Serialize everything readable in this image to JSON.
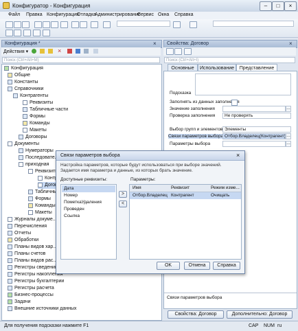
{
  "window": {
    "title": "Конфигуратор - Конфигурация"
  },
  "menu": [
    "Файл",
    "Правка",
    "Конфигурация",
    "Отладка",
    "Администрирование",
    "Сервис",
    "Окна",
    "Справка"
  ],
  "left_panel": {
    "title": "Конфигурация *",
    "actions_label": "Действия ▾",
    "search_placeholder": "Поиск (Ctrl+Alt+M)",
    "tree": [
      {
        "label": "Конфигурация",
        "icon": "config-icon"
      },
      {
        "label": "Общие",
        "icon": "folder-icon"
      },
      {
        "label": "Константы",
        "icon": "constant-icon"
      },
      {
        "label": "Справочники",
        "icon": "catalog-icon"
      },
      {
        "label": "Контрагенты",
        "icon": "catalog-icon"
      },
      {
        "label": "Реквизиты",
        "icon": "folder-icon"
      },
      {
        "label": "Табличные части",
        "icon": "table-icon"
      },
      {
        "label": "Формы",
        "icon": "form-icon"
      },
      {
        "label": "Команды",
        "icon": "command-icon"
      },
      {
        "label": "Макеты",
        "icon": "layout-icon"
      },
      {
        "label": "Договоры",
        "icon": "catalog-icon"
      },
      {
        "label": "Документы",
        "icon": "document-icon"
      },
      {
        "label": "Нумераторы",
        "icon": "numerator-icon"
      },
      {
        "label": "Последовате...",
        "icon": "sequence-icon"
      },
      {
        "label": "приходная",
        "icon": "document-icon"
      },
      {
        "label": "Реквизиты",
        "icon": "folder-icon"
      },
      {
        "label": "Контр...",
        "icon": "attribute-icon"
      },
      {
        "label": "Догов...",
        "icon": "attribute-icon"
      },
      {
        "label": "Табличны...",
        "icon": "table-icon"
      },
      {
        "label": "Формы",
        "icon": "form-icon"
      },
      {
        "label": "Команды",
        "icon": "command-icon"
      },
      {
        "label": "Макеты",
        "icon": "layout-icon"
      },
      {
        "label": "Журналы докуме...",
        "icon": "journal-icon"
      },
      {
        "label": "Перечисления",
        "icon": "enum-icon"
      },
      {
        "label": "Отчеты",
        "icon": "report-icon"
      },
      {
        "label": "Обработки",
        "icon": "processing-icon"
      },
      {
        "label": "Планы видов хар...",
        "icon": "chart-icon"
      },
      {
        "label": "Планы счетов",
        "icon": "accounts-icon"
      },
      {
        "label": "Планы видов рас...",
        "icon": "calc-icon"
      },
      {
        "label": "Регистры сведений",
        "icon": "register-icon"
      },
      {
        "label": "Регистры накопления",
        "icon": "register-icon"
      },
      {
        "label": "Регистры бухгалтерии",
        "icon": "register-icon"
      },
      {
        "label": "Регистры расчета",
        "icon": "register-icon"
      },
      {
        "label": "Бизнес-процессы",
        "icon": "process-icon"
      },
      {
        "label": "Задачи",
        "icon": "task-icon"
      },
      {
        "label": "Внешние источники данных",
        "icon": "datasource-icon"
      }
    ]
  },
  "right_panel": {
    "title": "Свойства: Договор",
    "search_placeholder": "Поиск (Ctrl+Alt+I)",
    "tabs": [
      "Основные",
      "Использование",
      "Представление"
    ],
    "props": {
      "hint_label": "Подсказка",
      "fill_from_label": "Заполнять из данных заполнения",
      "fill_value_label": "Значение заполнения",
      "fill_check_label": "Проверка заполнения",
      "fill_check_value": "Не проверять",
      "groups_label": "Выбор групп и элементов",
      "groups_value": "Элементы",
      "links_label": "Связи параметров выбора",
      "links_value": "Отбор.Владелец(Контрагент)",
      "params_label": "Параметры выбора"
    },
    "footer_label": "Связи параметров выбора",
    "bottom_tabs": [
      "Свойства: Договор",
      "Дополнительно: Договор"
    ]
  },
  "dialog": {
    "title": "Связи параметров выбора",
    "description": "Настройка параметров, которые будут использоваться при выборе значений. Задается имя параметра и данные, из которых брать значение.",
    "available_label": "Доступные реквизиты:",
    "available": [
      "Дата",
      "Номер",
      "ПометкаУдаления",
      "Проведен",
      "Ссылка"
    ],
    "params_label": "Параметры:",
    "columns": [
      "Имя",
      "Реквизит",
      "Режим изме..."
    ],
    "rows": [
      [
        "Отбор.Владелец",
        "Контрагент",
        "Очищать"
      ]
    ],
    "add_btn": ">",
    "remove_btn": "<",
    "ok": "OK",
    "cancel": "Отмена",
    "help": "Справка"
  },
  "status": {
    "hint": "Для получения подсказки нажмите F1",
    "cap": "CAP",
    "num": "NUM",
    "lang": "ru"
  }
}
